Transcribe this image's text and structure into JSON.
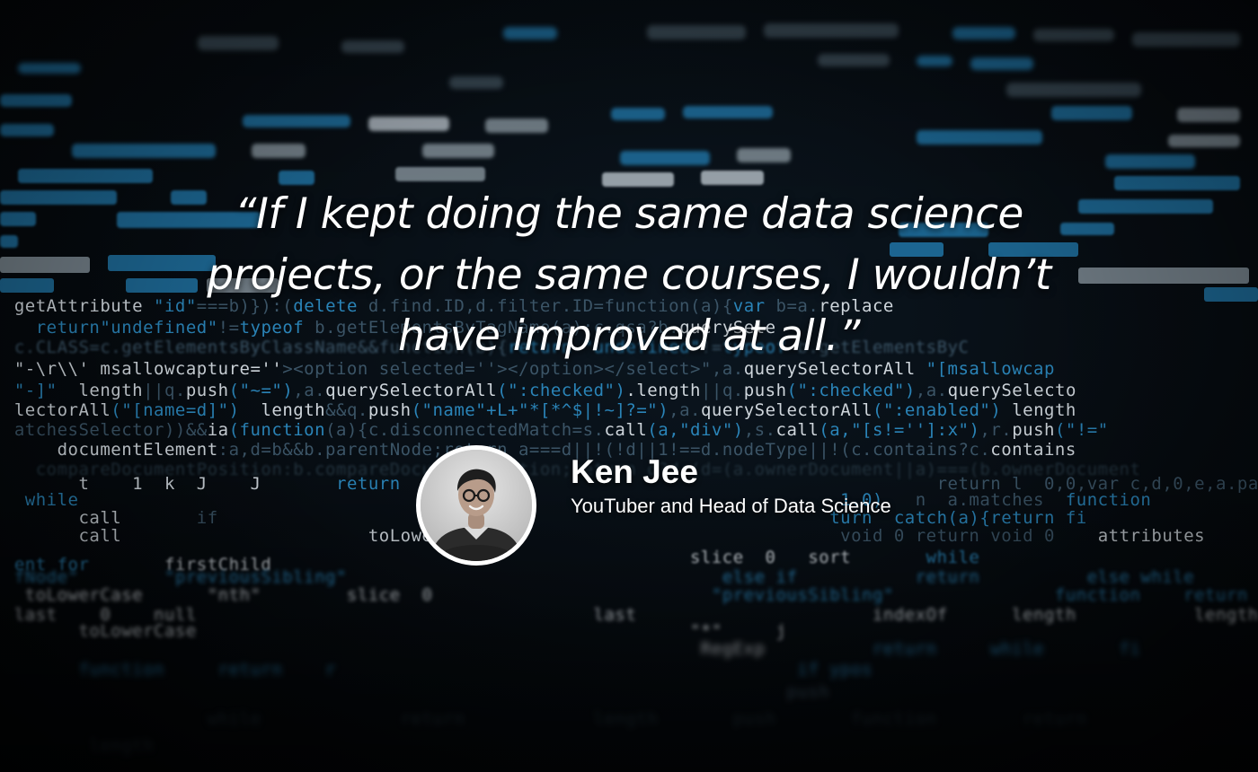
{
  "quote": {
    "line1": "“If I kept doing the same data science",
    "line2": "projects, or the same courses, I wouldn’t",
    "line3": "have improved at all.”"
  },
  "author": {
    "name": "Ken Jee",
    "role": "YouTuber and Head of Data Science"
  },
  "colors": {
    "background": "#060b10",
    "code_accent": "#2a84b8",
    "code_text": "#cfd6dc",
    "text": "#ffffff",
    "avatar_ring": "#ffffff"
  },
  "icons": {
    "avatar": "person-portrait-icon"
  }
}
